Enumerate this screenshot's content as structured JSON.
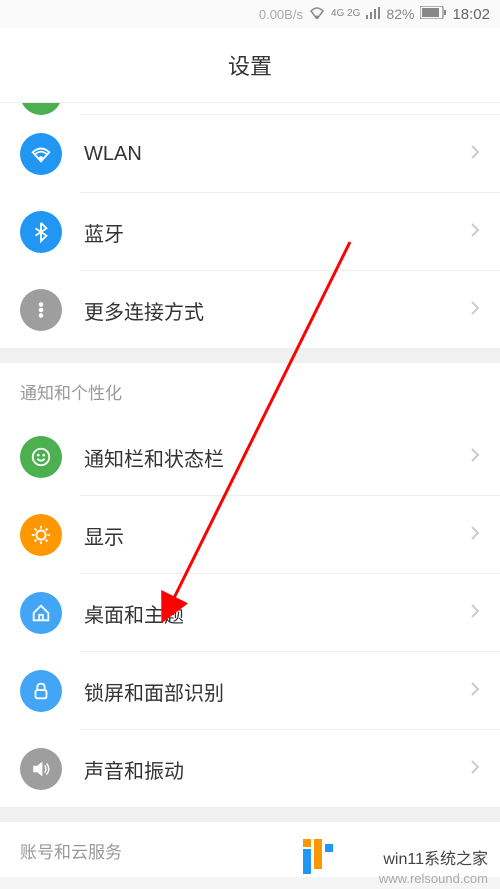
{
  "status_bar": {
    "speed": "0.00B/s",
    "network": "4G 2G",
    "battery": "82%",
    "time": "18:02"
  },
  "header": {
    "title": "设置"
  },
  "sections": {
    "connectivity": {
      "items": [
        {
          "label": "WLAN"
        },
        {
          "label": "蓝牙"
        },
        {
          "label": "更多连接方式"
        }
      ]
    },
    "notification_personalization": {
      "header": "通知和个性化",
      "items": [
        {
          "label": "通知栏和状态栏"
        },
        {
          "label": "显示"
        },
        {
          "label": "桌面和主题"
        },
        {
          "label": "锁屏和面部识别"
        },
        {
          "label": "声音和振动"
        }
      ]
    },
    "account_cloud": {
      "header": "账号和云服务"
    }
  },
  "watermarks": {
    "site": "win11系统之家",
    "url": "www.relsound.com"
  }
}
